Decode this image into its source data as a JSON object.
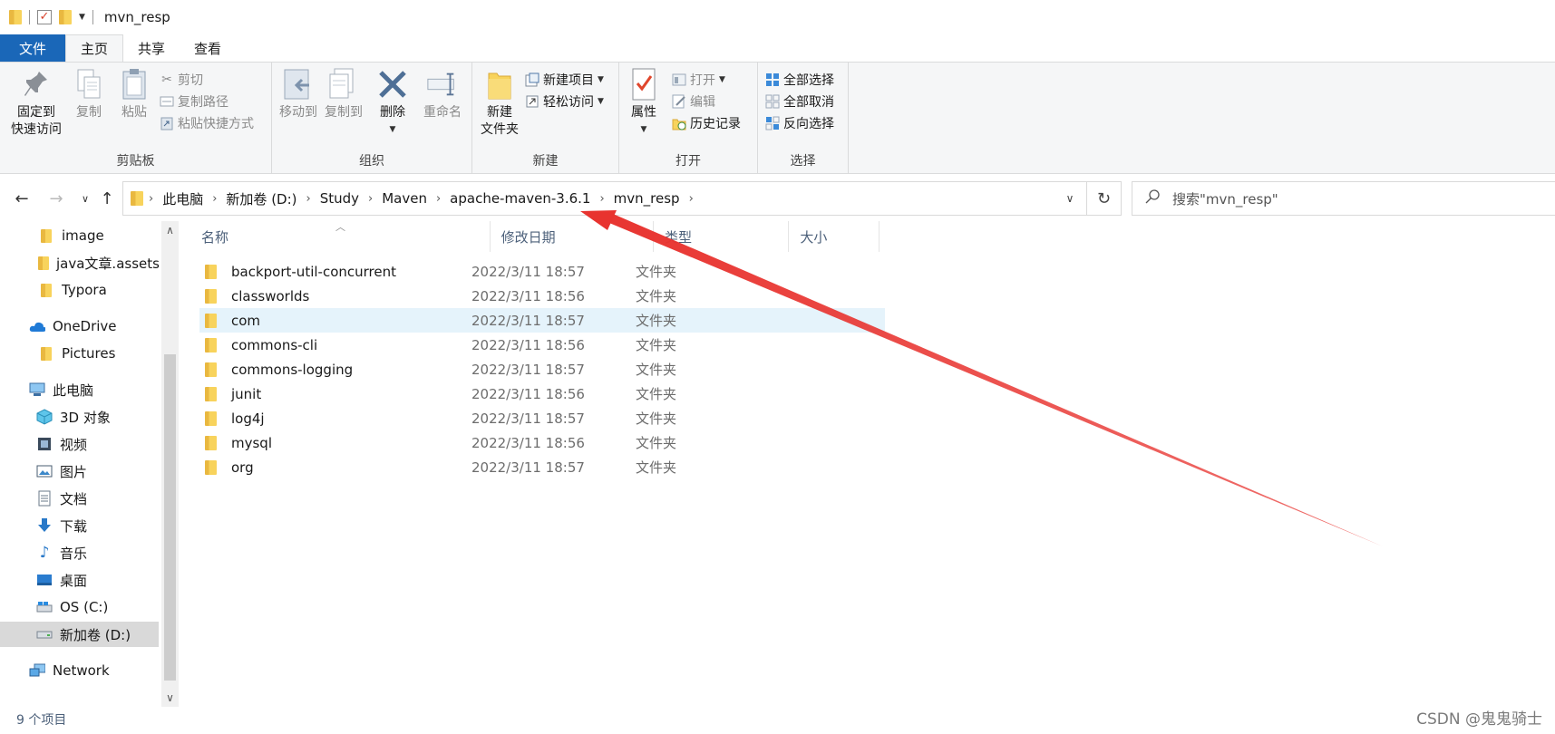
{
  "title_bar": {
    "window_title": "mvn_resp"
  },
  "tabs": [
    {
      "label": "文件"
    },
    {
      "label": "主页"
    },
    {
      "label": "共享"
    },
    {
      "label": "查看"
    }
  ],
  "ribbon": {
    "clipboard": {
      "group_label": "剪贴板",
      "pin_label_1": "固定到",
      "pin_label_2": "快速访问",
      "copy": "复制",
      "paste": "粘贴",
      "cut": "剪切",
      "copy_path": "复制路径",
      "paste_shortcut": "粘贴快捷方式"
    },
    "organize": {
      "group_label": "组织",
      "move_to": "移动到",
      "copy_to": "复制到",
      "delete": "删除",
      "rename": "重命名"
    },
    "new": {
      "group_label": "新建",
      "new_folder_1": "新建",
      "new_folder_2": "文件夹",
      "new_item": "新建项目",
      "easy_access": "轻松访问"
    },
    "open": {
      "group_label": "打开",
      "properties": "属性",
      "open": "打开",
      "edit": "编辑",
      "history": "历史记录"
    },
    "select": {
      "group_label": "选择",
      "select_all": "全部选择",
      "select_none": "全部取消",
      "invert": "反向选择"
    }
  },
  "address": {
    "breadcrumbs": [
      "此电脑",
      "新加卷 (D:)",
      "Study",
      "Maven",
      "apache-maven-3.6.1",
      "mvn_resp"
    ],
    "search_placeholder": "搜索\"mvn_resp\""
  },
  "sidebar": {
    "items": [
      {
        "label": "image",
        "icon": "folder-icon"
      },
      {
        "label": "java文章.assets",
        "icon": "folder-icon"
      },
      {
        "label": "Typora",
        "icon": "folder-icon"
      },
      {
        "label": "OneDrive",
        "icon": "cloud-icon"
      },
      {
        "label": "Pictures",
        "icon": "folder-icon"
      },
      {
        "label": "此电脑",
        "icon": "computer-icon"
      },
      {
        "label": "3D 对象",
        "icon": "cube-icon"
      },
      {
        "label": "视频",
        "icon": "video-icon"
      },
      {
        "label": "图片",
        "icon": "picture-icon"
      },
      {
        "label": "文档",
        "icon": "document-icon"
      },
      {
        "label": "下载",
        "icon": "download-icon"
      },
      {
        "label": "音乐",
        "icon": "music-icon"
      },
      {
        "label": "桌面",
        "icon": "desktop-icon"
      },
      {
        "label": "OS (C:)",
        "icon": "drive-icon"
      },
      {
        "label": "新加卷 (D:)",
        "icon": "drive-icon"
      },
      {
        "label": "Network",
        "icon": "network-icon"
      }
    ]
  },
  "file_list": {
    "columns": [
      "名称",
      "修改日期",
      "类型",
      "大小"
    ],
    "rows": [
      {
        "name": "backport-util-concurrent",
        "date": "2022/3/11 18:57",
        "type": "文件夹",
        "size": ""
      },
      {
        "name": "classworlds",
        "date": "2022/3/11 18:56",
        "type": "文件夹",
        "size": ""
      },
      {
        "name": "com",
        "date": "2022/3/11 18:57",
        "type": "文件夹",
        "size": ""
      },
      {
        "name": "commons-cli",
        "date": "2022/3/11 18:56",
        "type": "文件夹",
        "size": ""
      },
      {
        "name": "commons-logging",
        "date": "2022/3/11 18:57",
        "type": "文件夹",
        "size": ""
      },
      {
        "name": "junit",
        "date": "2022/3/11 18:56",
        "type": "文件夹",
        "size": ""
      },
      {
        "name": "log4j",
        "date": "2022/3/11 18:57",
        "type": "文件夹",
        "size": ""
      },
      {
        "name": "mysql",
        "date": "2022/3/11 18:56",
        "type": "文件夹",
        "size": ""
      },
      {
        "name": "org",
        "date": "2022/3/11 18:57",
        "type": "文件夹",
        "size": ""
      }
    ]
  },
  "status": {
    "item_count": "9 个项目"
  },
  "watermark": "CSDN @鬼鬼骑士",
  "colors": {
    "file_tab": "#1a67b8",
    "annotation_arrow": "#e8332f",
    "row_hover": "#e5f3fb"
  }
}
